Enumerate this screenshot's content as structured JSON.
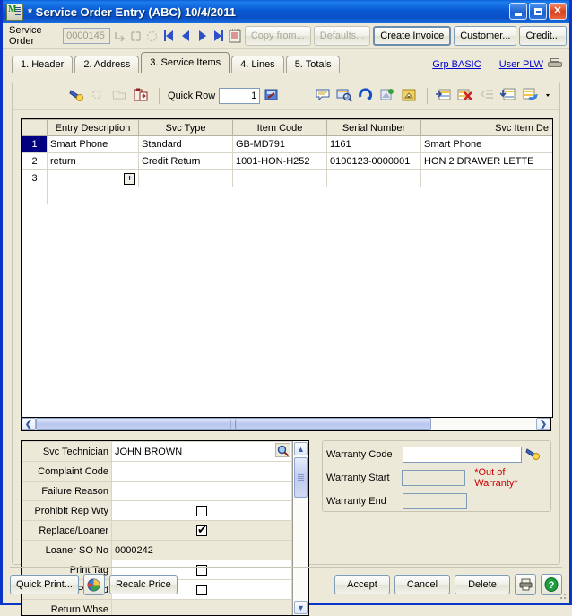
{
  "window": {
    "title": "* Service Order Entry (ABC) 10/4/2011",
    "icon": "app-icon",
    "minimize": "minimize-button",
    "maximize": "maximize-button",
    "close": "close-button"
  },
  "toolbar": {
    "service_order_label": "Service Order",
    "service_order_value": "0000145",
    "buttons": [
      {
        "label": "Copy from...",
        "disabled": true
      },
      {
        "label": "Defaults...",
        "disabled": true
      },
      {
        "label": "Create Invoice",
        "disabled": false
      },
      {
        "label": "Customer...",
        "disabled": false
      },
      {
        "label": "Credit...",
        "disabled": false
      }
    ],
    "nav": [
      "first-record",
      "previous-record",
      "next-record",
      "last-record",
      "list-records"
    ]
  },
  "tabs": [
    {
      "label": "1. Header",
      "active": false
    },
    {
      "label": "2. Address",
      "active": false
    },
    {
      "label": "3. Service Items",
      "active": true
    },
    {
      "label": "4. Lines",
      "active": false
    },
    {
      "label": "5. Totals",
      "active": false
    }
  ],
  "tab_links": {
    "group": "Grp BASIC",
    "user": "User PLW",
    "printer_icon": "printer-icon"
  },
  "grid_toolbar": {
    "quick_row_label": "Quick Row",
    "quick_row_value": "1",
    "left_icons": [
      "flashlight-icon",
      "sparkle-icon",
      "folder-open-icon",
      "paste-icon"
    ],
    "right_icons": [
      "comment-icon",
      "inquiry-icon",
      "refresh-icon",
      "export-icon",
      "home-icon"
    ],
    "far_right_icons": [
      "insert-row-icon",
      "delete-row-icon",
      "indent-icon",
      "fill-down-icon",
      "row-options-icon",
      "dropdown-caret-icon"
    ]
  },
  "grid": {
    "columns": [
      "",
      "Entry Description",
      "Svc Type",
      "Item Code",
      "Serial Number",
      "Svc Item De"
    ],
    "rows": [
      {
        "num": "1",
        "selected": true,
        "cells": [
          "Smart Phone",
          "Standard",
          "GB-MD791",
          "1161",
          "Smart Phone"
        ]
      },
      {
        "num": "2",
        "selected": false,
        "cells": [
          "return",
          "Credit Return",
          "1001-HON-H252",
          "0100123-0000001",
          "HON 2 DRAWER LETTE"
        ]
      },
      {
        "num": "3",
        "selected": false,
        "cells": [
          "",
          "",
          "",
          "",
          ""
        ],
        "has_expand": true,
        "expand_glyph": "+"
      }
    ]
  },
  "detail_fields": [
    {
      "label": "Svc Technician",
      "value": "JOHN BROWN",
      "type": "text-lookup",
      "shaded": false
    },
    {
      "label": "Complaint Code",
      "value": "",
      "type": "text",
      "shaded": false
    },
    {
      "label": "Failure Reason",
      "value": "",
      "type": "text",
      "shaded": false
    },
    {
      "label": "Prohibit Rep Wty",
      "value": "",
      "type": "checkbox",
      "checked": false,
      "shaded": false
    },
    {
      "label": "Replace/Loaner",
      "value": "",
      "type": "checkbox",
      "checked": true,
      "shaded": true
    },
    {
      "label": "Loaner SO No",
      "value": "0000242",
      "type": "text",
      "shaded": true
    },
    {
      "label": "Print Tag",
      "value": "",
      "type": "checkbox",
      "checked": false,
      "shaded": false
    },
    {
      "label": "Pick Sht Printed",
      "value": "",
      "type": "checkbox",
      "checked": false,
      "shaded": false
    },
    {
      "label": "Return Whse",
      "value": "",
      "type": "text",
      "shaded": true
    }
  ],
  "warranty": {
    "code_label": "Warranty Code",
    "code_value": "",
    "start_label": "Warranty Start",
    "start_value": "",
    "end_label": "Warranty End",
    "end_value": "",
    "status": "*Out of Warranty*",
    "status_color": "#cc0000",
    "lookup_icon": "flashlight-icon"
  },
  "bottom": {
    "quick_print": "Quick Print...",
    "print_settings_icon": "print-settings-icon",
    "recalc_price": "Recalc Price",
    "accept": "Accept",
    "cancel": "Cancel",
    "delete": "Delete",
    "printer_icon": "printer-icon",
    "help_icon": "help-icon"
  },
  "colors": {
    "titlebar_blue": "#0a5ad3",
    "window_face": "#ece9d8",
    "selection_navy": "#000080",
    "selected_cell": "#d9dcf7",
    "link_blue": "#0000cc",
    "warning_red": "#cc0000"
  }
}
